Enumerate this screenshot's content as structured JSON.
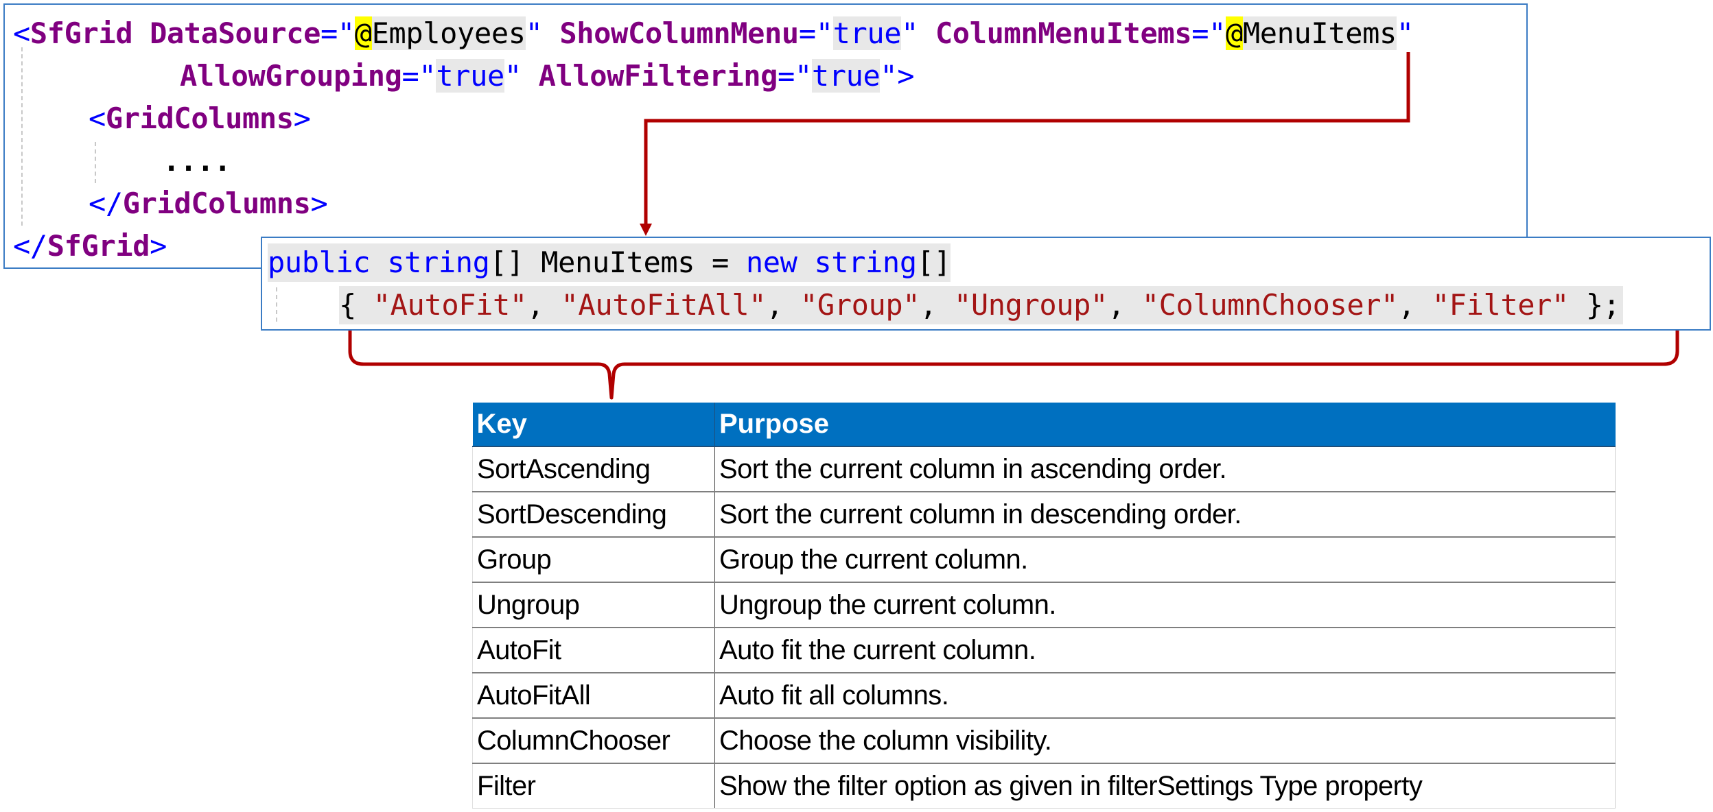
{
  "razor_block": {
    "line1": {
      "open": "<",
      "tag": "SfGrid",
      "attr1_name": " DataSource",
      "attr1_eq": "=",
      "attr1_q1": "\"",
      "attr1_at": "@",
      "attr1_expr": "Employees",
      "attr1_q2": "\"",
      "attr2_name": " ShowColumnMenu",
      "attr2_eq": "=",
      "attr2_q1": "\"",
      "attr2_value": "true",
      "attr2_q2": "\"",
      "attr3_name": " ColumnMenuItems",
      "attr3_eq": "=",
      "attr3_q1": "\"",
      "attr3_at": "@",
      "attr3_expr": "MenuItems",
      "attr3_q2": "\""
    },
    "line2": {
      "attr4_name": "AllowGrouping",
      "attr4_eq": "=",
      "attr4_q1": "\"",
      "attr4_value": "true",
      "attr4_q2": "\"",
      "attr5_name": " AllowFiltering",
      "attr5_eq": "=",
      "attr5_q1": "\"",
      "attr5_value": "true",
      "attr5_q2": "\"",
      "close": ">"
    },
    "line3": {
      "open": "<",
      "tag": "GridColumns",
      "close": ">"
    },
    "line4": {
      "text": "...."
    },
    "line5": {
      "open": "</",
      "tag": "GridColumns",
      "close": ">"
    },
    "line6": {
      "open": "</",
      "tag": "SfGrid",
      "close": ">"
    }
  },
  "csharp_block": {
    "line1": {
      "kw_public": "public",
      "kw_string": " string",
      "brackets": "[] MenuItems = ",
      "kw_new": "new",
      "kw_string2": " string",
      "brackets2": "[]"
    },
    "line2": {
      "open": "{ ",
      "items": [
        "\"AutoFit\"",
        "\"AutoFitAll\"",
        "\"Group\"",
        "\"Ungroup\"",
        "\"ColumnChooser\"",
        "\"Filter\""
      ],
      "sep": ", ",
      "close": " };"
    }
  },
  "table": {
    "headers": {
      "key": "Key",
      "purpose": "Purpose"
    },
    "rows": [
      {
        "key": "SortAscending",
        "purpose": "Sort the current column in ascending order."
      },
      {
        "key": "SortDescending",
        "purpose": "Sort the current column in descending order."
      },
      {
        "key": "Group",
        "purpose": "Group the current column."
      },
      {
        "key": "Ungroup",
        "purpose": "Ungroup the current column."
      },
      {
        "key": "AutoFit",
        "purpose": "Auto fit the current column."
      },
      {
        "key": "AutoFitAll",
        "purpose": "Auto fit all columns."
      },
      {
        "key": "ColumnChooser",
        "purpose": "Choose the column visibility."
      },
      {
        "key": "Filter",
        "purpose": "Show the filter option as given in filterSettings Type property"
      }
    ]
  },
  "colors": {
    "header_bg": "#0070C0",
    "annotation_red": "#B00000",
    "frame_blue": "#3B7CC4"
  }
}
